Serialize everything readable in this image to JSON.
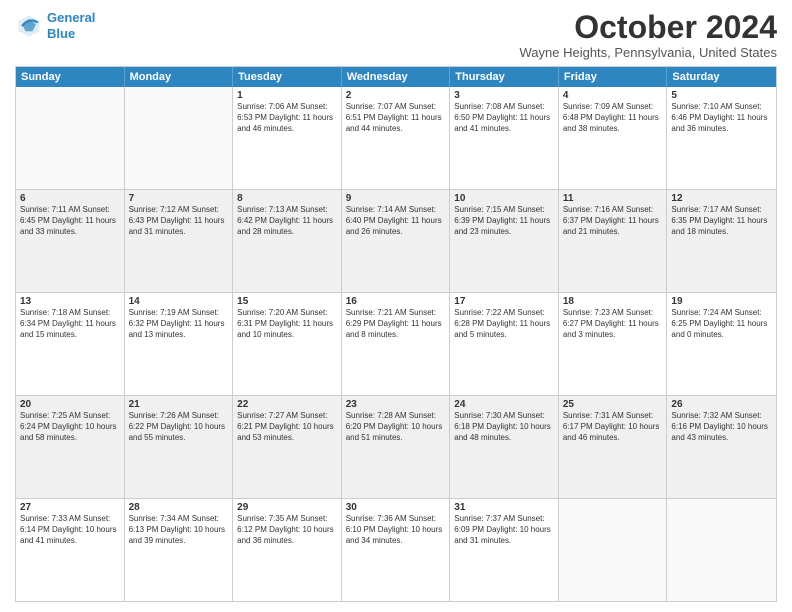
{
  "logo": {
    "line1": "General",
    "line2": "Blue"
  },
  "title": "October 2024",
  "subtitle": "Wayne Heights, Pennsylvania, United States",
  "header_days": [
    "Sunday",
    "Monday",
    "Tuesday",
    "Wednesday",
    "Thursday",
    "Friday",
    "Saturday"
  ],
  "rows": [
    [
      {
        "day": "",
        "text": "",
        "empty": true
      },
      {
        "day": "",
        "text": "",
        "empty": true
      },
      {
        "day": "1",
        "text": "Sunrise: 7:06 AM\nSunset: 6:53 PM\nDaylight: 11 hours and 46 minutes."
      },
      {
        "day": "2",
        "text": "Sunrise: 7:07 AM\nSunset: 6:51 PM\nDaylight: 11 hours and 44 minutes."
      },
      {
        "day": "3",
        "text": "Sunrise: 7:08 AM\nSunset: 6:50 PM\nDaylight: 11 hours and 41 minutes."
      },
      {
        "day": "4",
        "text": "Sunrise: 7:09 AM\nSunset: 6:48 PM\nDaylight: 11 hours and 38 minutes."
      },
      {
        "day": "5",
        "text": "Sunrise: 7:10 AM\nSunset: 6:46 PM\nDaylight: 11 hours and 36 minutes."
      }
    ],
    [
      {
        "day": "6",
        "text": "Sunrise: 7:11 AM\nSunset: 6:45 PM\nDaylight: 11 hours and 33 minutes.",
        "shaded": true
      },
      {
        "day": "7",
        "text": "Sunrise: 7:12 AM\nSunset: 6:43 PM\nDaylight: 11 hours and 31 minutes.",
        "shaded": true
      },
      {
        "day": "8",
        "text": "Sunrise: 7:13 AM\nSunset: 6:42 PM\nDaylight: 11 hours and 28 minutes.",
        "shaded": true
      },
      {
        "day": "9",
        "text": "Sunrise: 7:14 AM\nSunset: 6:40 PM\nDaylight: 11 hours and 26 minutes.",
        "shaded": true
      },
      {
        "day": "10",
        "text": "Sunrise: 7:15 AM\nSunset: 6:39 PM\nDaylight: 11 hours and 23 minutes.",
        "shaded": true
      },
      {
        "day": "11",
        "text": "Sunrise: 7:16 AM\nSunset: 6:37 PM\nDaylight: 11 hours and 21 minutes.",
        "shaded": true
      },
      {
        "day": "12",
        "text": "Sunrise: 7:17 AM\nSunset: 6:35 PM\nDaylight: 11 hours and 18 minutes.",
        "shaded": true
      }
    ],
    [
      {
        "day": "13",
        "text": "Sunrise: 7:18 AM\nSunset: 6:34 PM\nDaylight: 11 hours and 15 minutes."
      },
      {
        "day": "14",
        "text": "Sunrise: 7:19 AM\nSunset: 6:32 PM\nDaylight: 11 hours and 13 minutes."
      },
      {
        "day": "15",
        "text": "Sunrise: 7:20 AM\nSunset: 6:31 PM\nDaylight: 11 hours and 10 minutes."
      },
      {
        "day": "16",
        "text": "Sunrise: 7:21 AM\nSunset: 6:29 PM\nDaylight: 11 hours and 8 minutes."
      },
      {
        "day": "17",
        "text": "Sunrise: 7:22 AM\nSunset: 6:28 PM\nDaylight: 11 hours and 5 minutes."
      },
      {
        "day": "18",
        "text": "Sunrise: 7:23 AM\nSunset: 6:27 PM\nDaylight: 11 hours and 3 minutes."
      },
      {
        "day": "19",
        "text": "Sunrise: 7:24 AM\nSunset: 6:25 PM\nDaylight: 11 hours and 0 minutes."
      }
    ],
    [
      {
        "day": "20",
        "text": "Sunrise: 7:25 AM\nSunset: 6:24 PM\nDaylight: 10 hours and 58 minutes.",
        "shaded": true
      },
      {
        "day": "21",
        "text": "Sunrise: 7:26 AM\nSunset: 6:22 PM\nDaylight: 10 hours and 55 minutes.",
        "shaded": true
      },
      {
        "day": "22",
        "text": "Sunrise: 7:27 AM\nSunset: 6:21 PM\nDaylight: 10 hours and 53 minutes.",
        "shaded": true
      },
      {
        "day": "23",
        "text": "Sunrise: 7:28 AM\nSunset: 6:20 PM\nDaylight: 10 hours and 51 minutes.",
        "shaded": true
      },
      {
        "day": "24",
        "text": "Sunrise: 7:30 AM\nSunset: 6:18 PM\nDaylight: 10 hours and 48 minutes.",
        "shaded": true
      },
      {
        "day": "25",
        "text": "Sunrise: 7:31 AM\nSunset: 6:17 PM\nDaylight: 10 hours and 46 minutes.",
        "shaded": true
      },
      {
        "day": "26",
        "text": "Sunrise: 7:32 AM\nSunset: 6:16 PM\nDaylight: 10 hours and 43 minutes.",
        "shaded": true
      }
    ],
    [
      {
        "day": "27",
        "text": "Sunrise: 7:33 AM\nSunset: 6:14 PM\nDaylight: 10 hours and 41 minutes."
      },
      {
        "day": "28",
        "text": "Sunrise: 7:34 AM\nSunset: 6:13 PM\nDaylight: 10 hours and 39 minutes."
      },
      {
        "day": "29",
        "text": "Sunrise: 7:35 AM\nSunset: 6:12 PM\nDaylight: 10 hours and 36 minutes."
      },
      {
        "day": "30",
        "text": "Sunrise: 7:36 AM\nSunset: 6:10 PM\nDaylight: 10 hours and 34 minutes."
      },
      {
        "day": "31",
        "text": "Sunrise: 7:37 AM\nSunset: 6:09 PM\nDaylight: 10 hours and 31 minutes."
      },
      {
        "day": "",
        "text": "",
        "empty": true
      },
      {
        "day": "",
        "text": "",
        "empty": true
      }
    ]
  ]
}
